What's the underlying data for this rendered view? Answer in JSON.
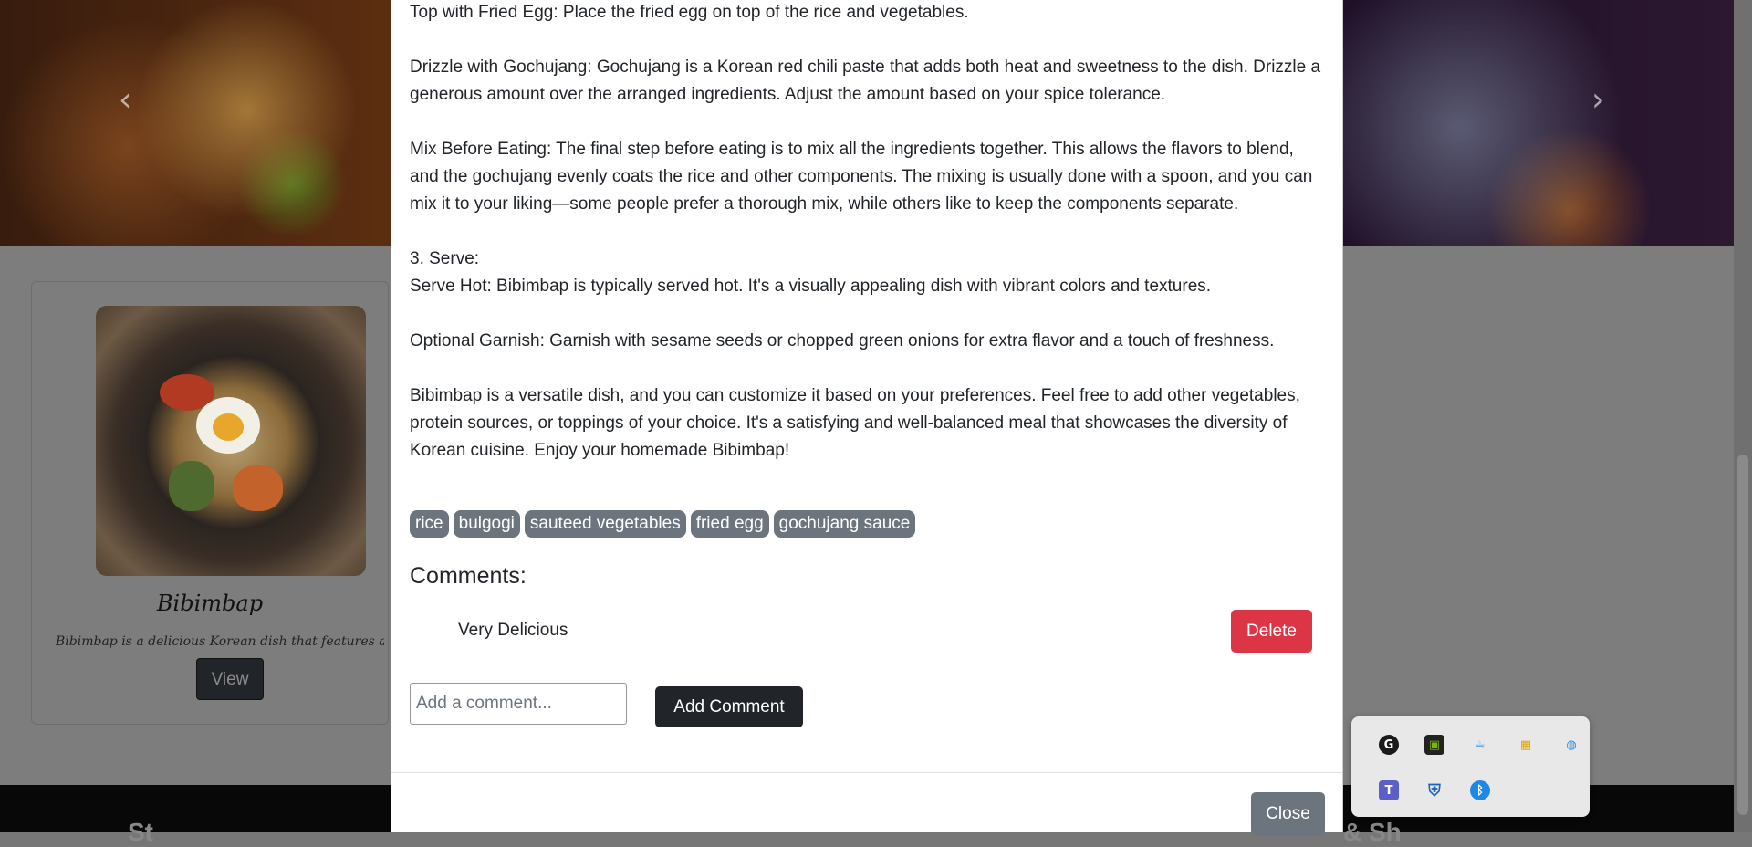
{
  "carousel": {
    "prev_glyph": "‹",
    "next_glyph": "›"
  },
  "card": {
    "title": "Bibimbap",
    "description": "Bibimbap is a delicious Korean dish that features a colo",
    "view_label": "View"
  },
  "footer": {
    "left_text": "St",
    "right_text": "& Sh"
  },
  "modal": {
    "paragraphs": [
      "Top with Fried Egg: Place the fried egg on top of the rice and vegetables.",
      "Drizzle with Gochujang: Gochujang is a Korean red chili paste that adds both heat and sweetness to the dish. Drizzle a generous amount over the arranged ingredients. Adjust the amount based on your spice tolerance.",
      "Mix Before Eating: The final step before eating is to mix all the ingredients together. This allows the flavors to blend, and the gochujang evenly coats the rice and other components. The mixing is usually done with a spoon, and you can mix it to your liking—some people prefer a thorough mix, while others like to keep the components separate.",
      "3. Serve:",
      "Serve Hot: Bibimbap is typically served hot. It's a visually appealing dish with vibrant colors and textures.",
      "Optional Garnish: Garnish with sesame seeds or chopped green onions for extra flavor and a touch of freshness.",
      "Bibimbap is a versatile dish, and you can customize it based on your preferences. Feel free to add other vegetables, protein sources, or toppings of your choice. It's a satisfying and well-balanced meal that showcases the diversity of Korean cuisine. Enjoy your homemade Bibimbap!"
    ],
    "tags": [
      "rice",
      "bulgogi",
      "sauteed vegetables",
      "fried egg",
      "gochujang sauce"
    ],
    "comments_heading": "Comments:",
    "comments": [
      {
        "text": "Very Delicious",
        "delete_label": "Delete"
      }
    ],
    "comment_placeholder": "Add a comment...",
    "add_comment_label": "Add Comment",
    "close_label": "Close"
  },
  "tray": {
    "icons": [
      {
        "name": "logitech-g-icon",
        "glyph": "G",
        "color": "#1a1a1a"
      },
      {
        "name": "nvidia-icon",
        "glyph": "▣",
        "color": "#76b900"
      },
      {
        "name": "coffee-cup-icon",
        "glyph": "☕",
        "color": "#1e88e5"
      },
      {
        "name": "colorful-app-icon",
        "glyph": "▦",
        "color": "#e0a000"
      },
      {
        "name": "network-globe-icon",
        "glyph": "◍",
        "color": "#1e88e5"
      },
      {
        "name": "teams-icon",
        "glyph": "T",
        "color": "#5b5fc7"
      },
      {
        "name": "security-shield-warning-icon",
        "glyph": "⛨",
        "color": "#1565c0"
      },
      {
        "name": "bluetooth-icon",
        "glyph": "ᛒ",
        "color": "#1e88e5"
      }
    ]
  }
}
